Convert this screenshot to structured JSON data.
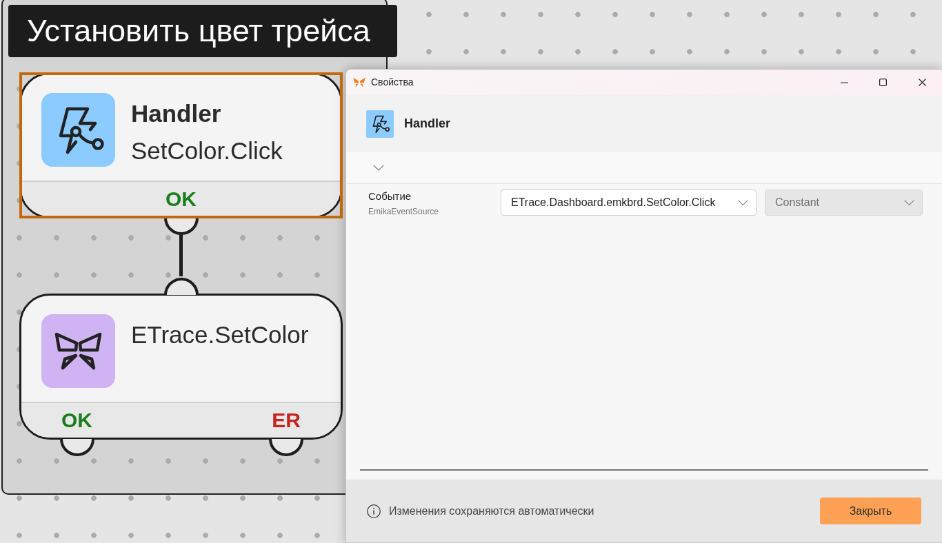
{
  "canvas": {
    "group": {
      "title": "Установить цвет трейса"
    },
    "nodes": [
      {
        "kind": "handler",
        "title": "Handler",
        "subtitle": "SetColor.Click",
        "selected": true,
        "outputs": [
          {
            "kind": "ok",
            "label": "OK"
          }
        ]
      },
      {
        "kind": "action",
        "title": "ETrace.SetColor",
        "selected": false,
        "outputs": [
          {
            "kind": "ok",
            "label": "OK"
          },
          {
            "kind": "error",
            "label": "ER"
          }
        ]
      }
    ]
  },
  "properties_window": {
    "title": "Свойства",
    "header": {
      "kind": "handler",
      "title": "Handler"
    },
    "properties": [
      {
        "label": "Событие",
        "type": "EmikaEventSource",
        "value": "ETrace.Dashboard.emkbrd.SetColor.Click",
        "mode": {
          "value": "Constant",
          "disabled": true
        }
      }
    ],
    "note": "Изменения сохраняются автоматически",
    "close_button": "Закрыть"
  }
}
